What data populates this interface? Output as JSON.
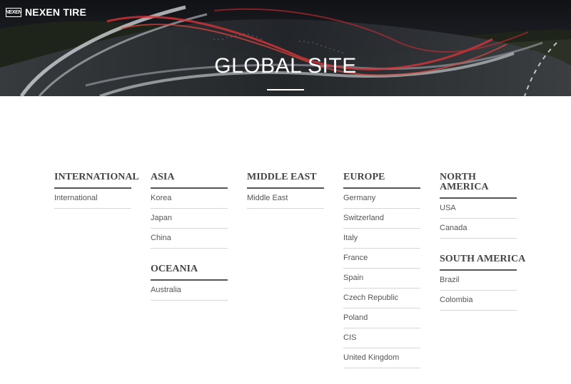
{
  "header": {
    "logo_mark": "NEXEN",
    "logo_text": "NEXEN TIRE",
    "title": "GLOBAL SITE"
  },
  "regions": [
    {
      "groups": [
        {
          "title": "INTERNATIONAL",
          "links": [
            "International"
          ]
        }
      ]
    },
    {
      "groups": [
        {
          "title": "ASIA",
          "links": [
            "Korea",
            "Japan",
            "China"
          ]
        },
        {
          "title": "OCEANIA",
          "links": [
            "Australia"
          ]
        }
      ]
    },
    {
      "groups": [
        {
          "title": "MIDDLE EAST",
          "links": [
            "Middle East"
          ]
        }
      ]
    },
    {
      "groups": [
        {
          "title": "EUROPE",
          "links": [
            "Germany",
            "Switzerland",
            "Italy",
            "France",
            "Spain",
            "Czech Republic",
            "Poland",
            "CIS",
            "United Kingdom"
          ]
        }
      ]
    },
    {
      "groups": [
        {
          "title": "NORTH AMERICA",
          "links": [
            "USA",
            "Canada"
          ]
        },
        {
          "title": "SOUTH AMERICA",
          "links": [
            "Brazil",
            "Colombia"
          ]
        }
      ]
    }
  ]
}
